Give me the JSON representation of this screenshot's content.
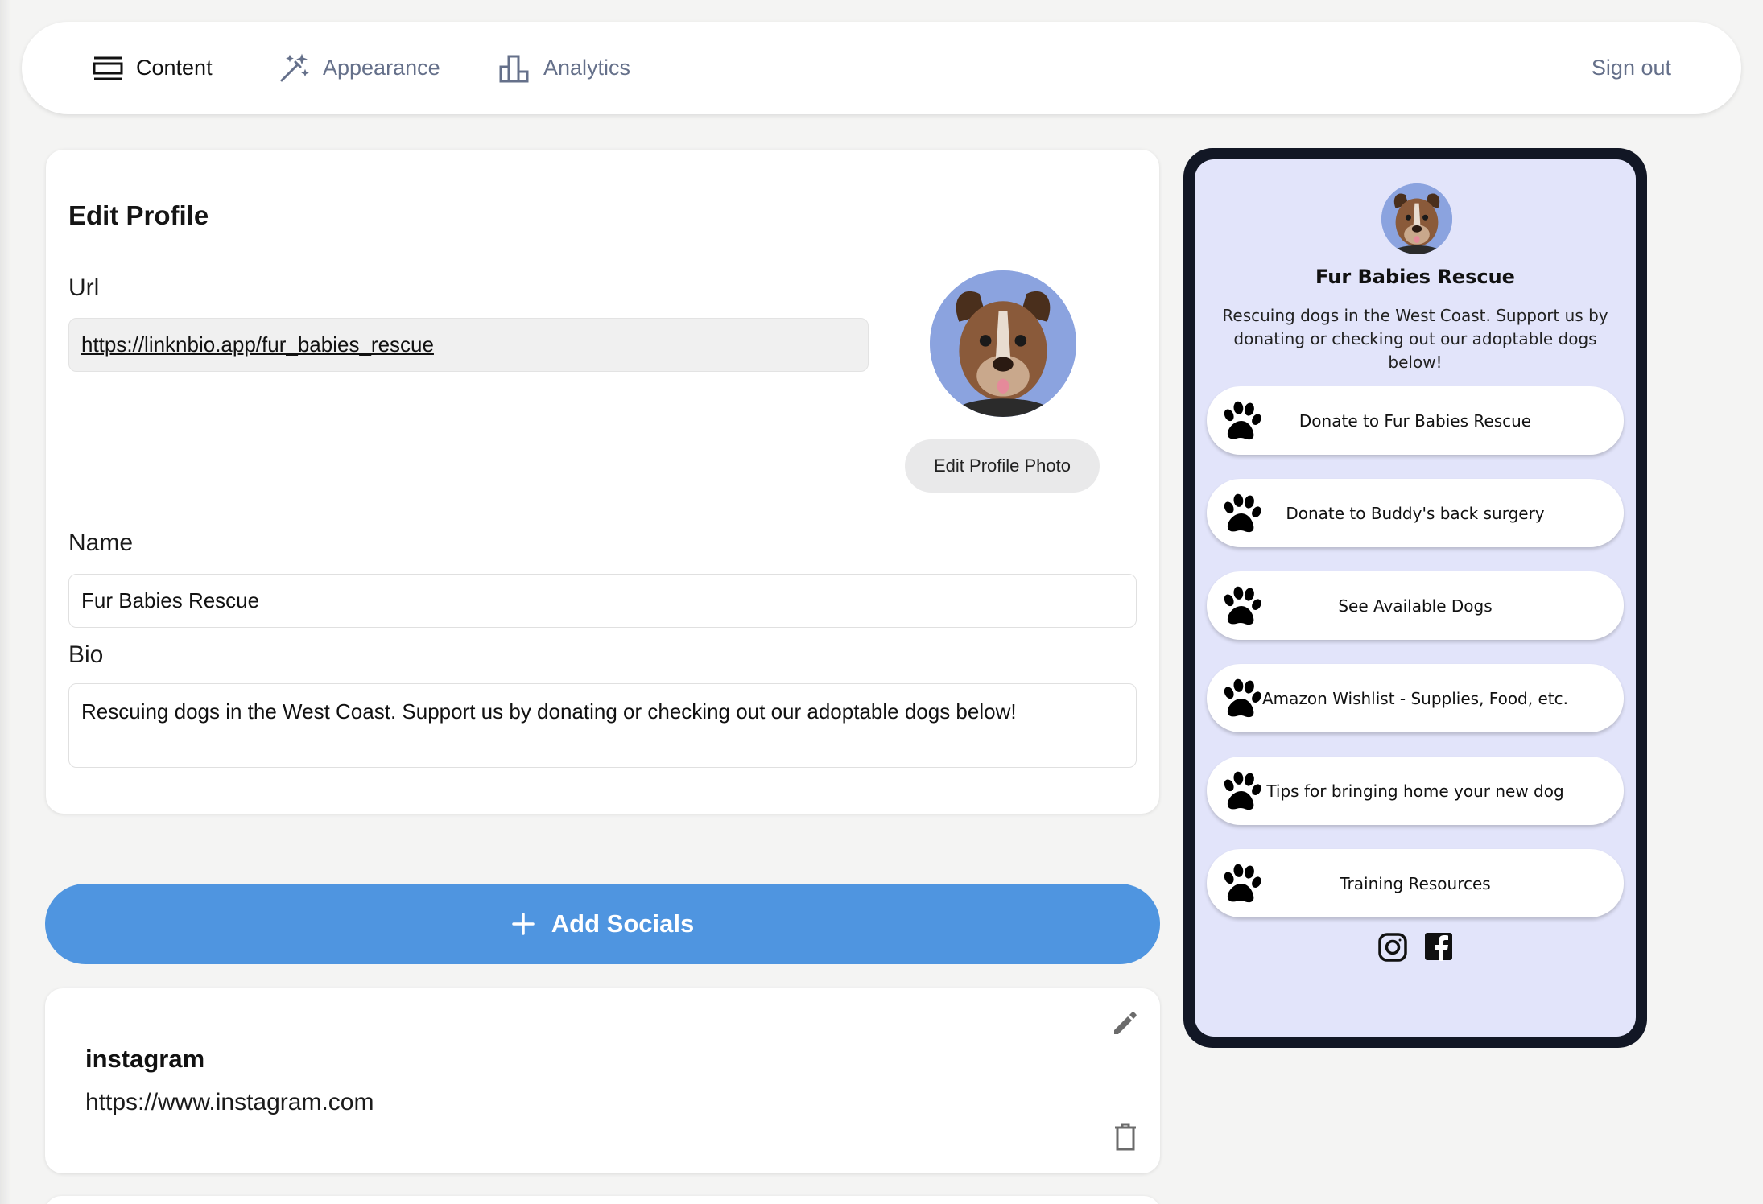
{
  "nav": {
    "tabs": [
      {
        "label": "Content",
        "icon": "layout-icon",
        "active": true
      },
      {
        "label": "Appearance",
        "icon": "magic-wand-icon",
        "active": false
      },
      {
        "label": "Analytics",
        "icon": "bar-chart-icon",
        "active": false
      }
    ],
    "signout_label": "Sign out"
  },
  "profile": {
    "title": "Edit Profile",
    "url_label": "Url",
    "url_value": "https://linknbio.app/fur_babies_rescue",
    "edit_photo_label": "Edit Profile Photo",
    "name_label": "Name",
    "name_value": "Fur Babies Rescue",
    "bio_label": "Bio",
    "bio_value": "Rescuing dogs in the West Coast. Support us by donating or checking out our adoptable dogs below!"
  },
  "add_socials": {
    "label": "Add Socials",
    "icon": "plus-icon"
  },
  "socials": [
    {
      "name": "instagram",
      "url": "https://www.instagram.com"
    }
  ],
  "preview": {
    "name": "Fur Babies Rescue",
    "bio": "Rescuing dogs in the West Coast. Support us by donating or checking out our adoptable dogs below!",
    "links": [
      {
        "label": "Donate to Fur Babies Rescue",
        "icon": "paw-icon"
      },
      {
        "label": "Donate to Buddy's back surgery",
        "icon": "paw-icon"
      },
      {
        "label": "See Available Dogs",
        "icon": "paw-icon"
      },
      {
        "label": "Amazon Wishlist - Supplies, Food, etc.",
        "icon": "paw-icon"
      },
      {
        "label": "Tips for bringing home your new dog",
        "icon": "paw-icon"
      },
      {
        "label": "Training Resources",
        "icon": "paw-icon"
      }
    ],
    "social_icons": [
      "instagram-icon",
      "facebook-icon"
    ]
  },
  "colors": {
    "accent": "#4f95e0",
    "preview_bg": "#e2e4fa",
    "phone_frame": "#121725",
    "nav_muted": "#65708a"
  }
}
